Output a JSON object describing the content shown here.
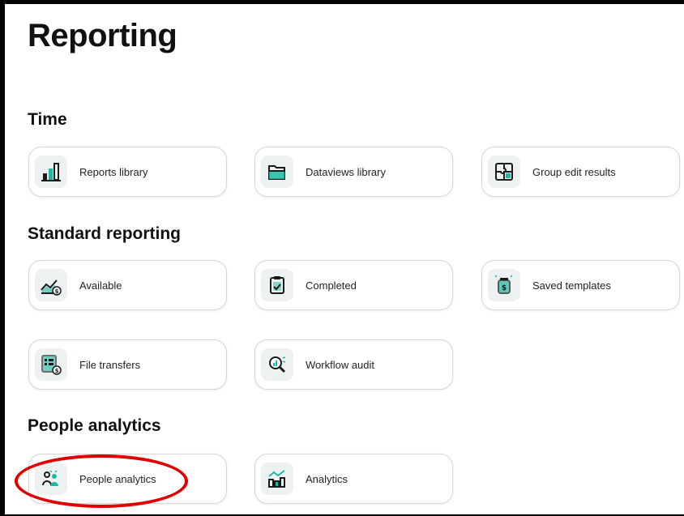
{
  "page": {
    "title": "Reporting"
  },
  "sections": [
    {
      "title": "Time",
      "tiles": [
        {
          "label": "Reports library",
          "icon": "bar-chart-icon"
        },
        {
          "label": "Dataviews library",
          "icon": "folder-icon"
        },
        {
          "label": "Group edit results",
          "icon": "puzzle-icon"
        }
      ]
    },
    {
      "title": "Standard reporting",
      "tiles": [
        {
          "label": "Available",
          "icon": "chart-dollar-icon"
        },
        {
          "label": "Completed",
          "icon": "clipboard-check-icon"
        },
        {
          "label": "Saved templates",
          "icon": "money-jar-icon"
        },
        {
          "label": "File transfers",
          "icon": "file-grid-dollar-icon"
        },
        {
          "label": "Workflow audit",
          "icon": "magnify-chart-icon"
        }
      ]
    },
    {
      "title": "People analytics",
      "tiles": [
        {
          "label": "People analytics",
          "icon": "people-icon"
        },
        {
          "label": "Analytics",
          "icon": "analytics-icon"
        }
      ]
    }
  ],
  "colors": {
    "accent": "#1fb8a2",
    "highlight": "#e00000",
    "icon_bg": "#eef1f1",
    "tile_border": "#d6d6d6"
  }
}
